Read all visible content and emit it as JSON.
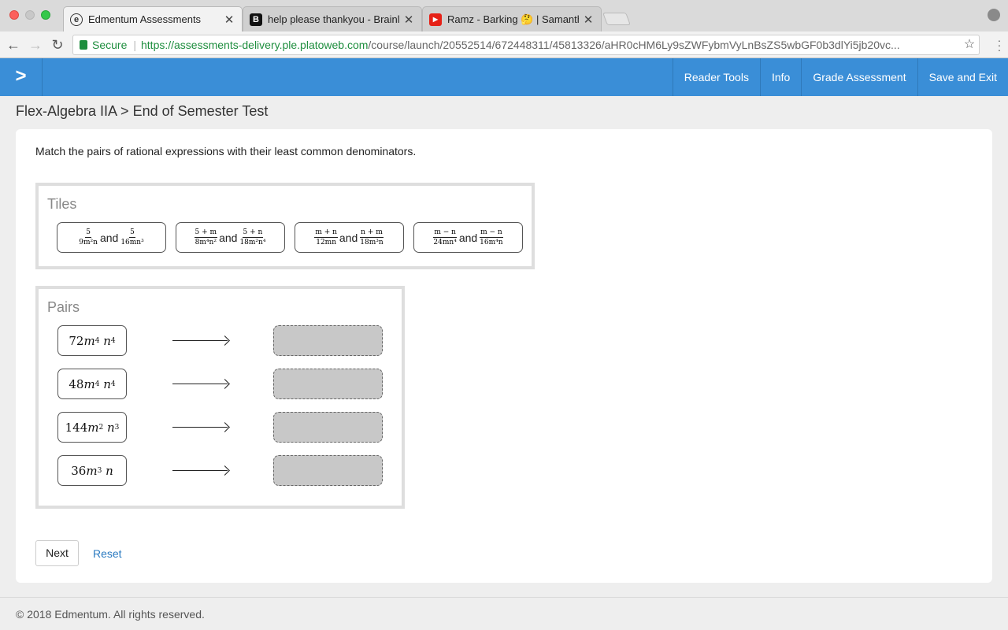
{
  "browser": {
    "tabs": [
      {
        "title": "Edmentum Assessments",
        "favicon": "edmentum-icon",
        "active": true
      },
      {
        "title": "help please thankyou - Brainly",
        "favicon": "brainly-icon",
        "active": false
      },
      {
        "title": "Ramz - Barking 🤔 | Samantha",
        "favicon": "youtube-icon",
        "active": false
      }
    ],
    "secure_label": "Secure",
    "url_scheme_host": "https://assessments-delivery.ple.platoweb.com",
    "url_path": "/course/launch/20552514/672448311/45813326/aHR0cHM6Ly9sZWFybmVyLnBsZS5wbGF0b3dlYi5jb20vc..."
  },
  "appbar": {
    "expand_icon": ">",
    "nav": [
      "Reader Tools",
      "Info",
      "Grade Assessment",
      "Save and Exit"
    ],
    "accent": "#3a8ed7"
  },
  "breadcrumb": "Flex-Algebra IIA > End of Semester Test",
  "question": {
    "prompt": "Match the pairs of rational expressions with their least common denominators.",
    "tiles_label": "Tiles",
    "pairs_label": "Pairs",
    "and_word": "and"
  },
  "tiles": [
    {
      "a_num": "5",
      "a_den": "9m²n",
      "b_num": "5",
      "b_den": "16mn³"
    },
    {
      "a_num": "5 + m",
      "a_den": "8m⁴n²",
      "b_num": "5 + n",
      "b_den": "18m²n⁴"
    },
    {
      "a_num": "m + n",
      "a_den": "12mn",
      "b_num": "n + m",
      "b_den": "18m³n"
    },
    {
      "a_num": "m − n",
      "a_den": "24mn⁴",
      "b_num": "m − n",
      "b_den": "16m⁴n"
    }
  ],
  "pairs": [
    {
      "coef": "72",
      "m_exp": "4",
      "n_exp": "4"
    },
    {
      "coef": "48",
      "m_exp": "4",
      "n_exp": "4"
    },
    {
      "coef": "144",
      "m_exp": "2",
      "n_exp": "3"
    },
    {
      "coef": "36",
      "m_exp": "3",
      "n_exp": ""
    }
  ],
  "buttons": {
    "next": "Next",
    "reset": "Reset"
  },
  "footer": "© 2018 Edmentum. All rights reserved."
}
